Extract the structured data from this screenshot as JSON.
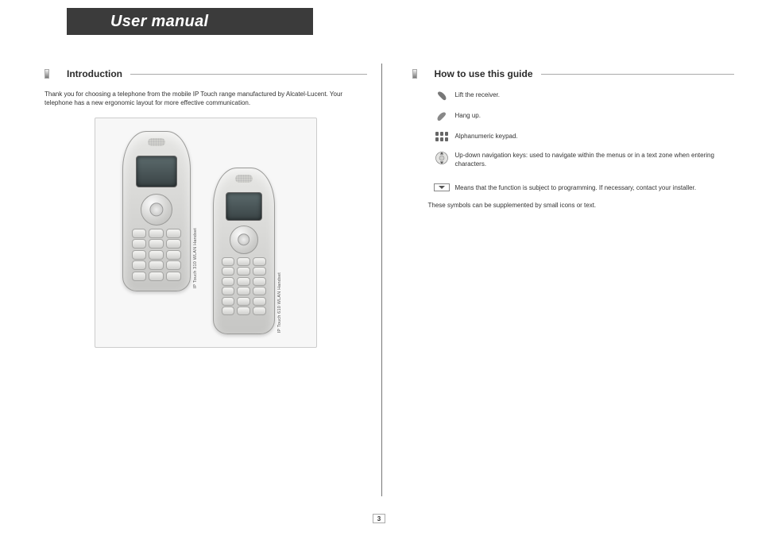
{
  "header": {
    "title": "User manual"
  },
  "left": {
    "section_title": "Introduction",
    "intro_text": "Thank you for choosing a telephone from the mobile IP Touch range manufactured by Alcatel-Lucent. Your telephone has a new ergonomic layout for more effective communication.",
    "phone_labels": [
      "IP Touch 310 WLAN Handset",
      "IP Touch 610 WLAN Handset"
    ]
  },
  "right": {
    "section_title": "How to use this guide",
    "items": [
      {
        "icon": "lift-receiver-icon",
        "text": "Lift the receiver."
      },
      {
        "icon": "hang-up-icon",
        "text": "Hang up."
      },
      {
        "icon": "keypad-icon",
        "text": "Alphanumeric keypad."
      },
      {
        "icon": "nav-keys-icon",
        "text": "Up-down navigation keys: used to navigate within the menus or in a text zone when entering characters."
      },
      {
        "icon": "programming-box-icon",
        "text": "Means that the function is subject to programming. If necessary, contact your installer."
      }
    ],
    "supplement": "These symbols can be supplemented by small icons or text."
  },
  "footer": {
    "page_number": "3"
  }
}
